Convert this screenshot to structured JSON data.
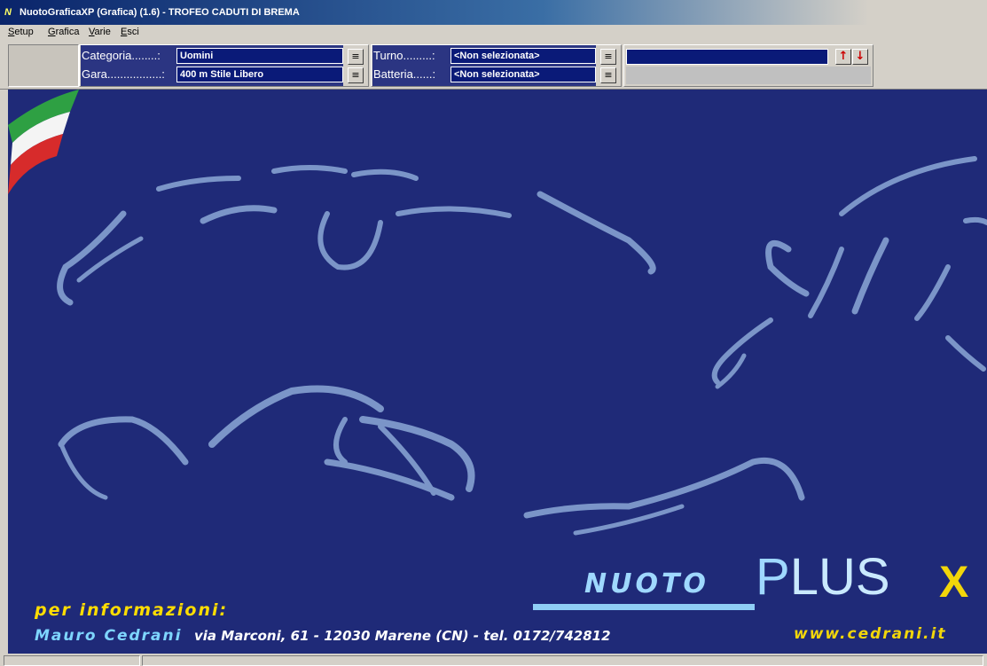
{
  "window": {
    "title": "NuotoGraficaXP (Grafica) (1.6) - TROFEO CADUTI DI BREMA",
    "icon": "app-logo-icon",
    "icon_text": "N"
  },
  "menu": {
    "items": [
      "Setup",
      "Grafica",
      "Varie",
      "Esci"
    ]
  },
  "toolbar": {
    "categoria": {
      "label": "Categoria........:",
      "value": "Uomini"
    },
    "gara": {
      "label": "Gara.................:",
      "value": "400 m Stile Libero"
    },
    "turno": {
      "label": "Turno.........:",
      "value": "<Non selezionata>"
    },
    "batteria": {
      "label": "Batteria......:",
      "value": "<Non selezionata>"
    },
    "extra_value": "",
    "up_arrow": "↑",
    "down_arrow": "↓",
    "pick_icon": "copy-list-icon"
  },
  "canvas": {
    "background_color": "#1f2a78",
    "info_label": "per informazioni:",
    "contact_name": "Mauro Cedrani",
    "contact_address": "via Marconi, 61 - 12030 Marene (CN) - tel. 0172/742812",
    "brand_nuoto": "NUOTO",
    "brand_p": "P",
    "brand_lus": "LUS",
    "brand_x": "X",
    "website": "www.cedrani.it"
  },
  "statusbar": {
    "panes": [
      "",
      ""
    ]
  }
}
